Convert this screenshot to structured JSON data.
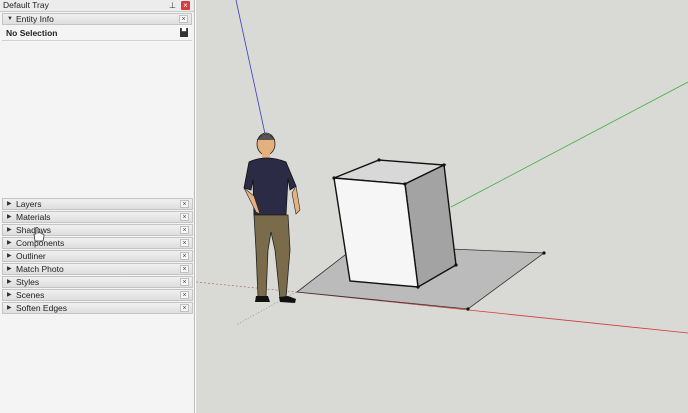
{
  "tray": {
    "title": "Default Tray",
    "pin_icon": "pin-icon",
    "close_label": "×"
  },
  "entity_info": {
    "label": "Entity Info",
    "selection": "No Selection",
    "expanded": true
  },
  "panels": [
    {
      "label": "Layers"
    },
    {
      "label": "Materials"
    },
    {
      "label": "Shadows"
    },
    {
      "label": "Components"
    },
    {
      "label": "Outliner"
    },
    {
      "label": "Match Photo"
    },
    {
      "label": "Styles"
    },
    {
      "label": "Scenes"
    },
    {
      "label": "Soften Edges"
    }
  ],
  "colors": {
    "viewport_bg": "#d9d9d5",
    "axis_red": "#d23c3c",
    "axis_green": "#3fb03f",
    "axis_blue": "#3a3acb"
  }
}
